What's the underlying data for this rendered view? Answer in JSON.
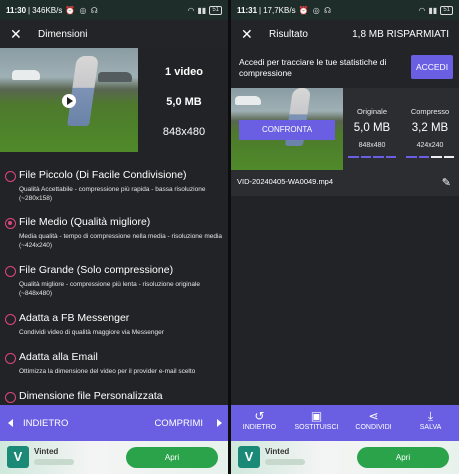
{
  "left": {
    "status": {
      "time": "11:30",
      "speed": "346KB/s",
      "battery": "51"
    },
    "appbar": {
      "title": "Dimensioni"
    },
    "video": {
      "count": "1 video",
      "size": "5,0 MB",
      "resolution": "848x480"
    },
    "options": [
      {
        "title": "File Piccolo (Di Facile Condivisione)",
        "desc": "Qualità Accettabile - compressione più rapida - bassa risoluzione (~280x158)",
        "selected": false
      },
      {
        "title": "File Medio (Qualità migliore)",
        "desc": "Media qualità - tempo di compressione nella media - risoluzione media (~424x240)",
        "selected": true
      },
      {
        "title": "File Grande (Solo compressione)",
        "desc": "Qualità migliore - compressione più lenta - risoluzione originale (~848x480)",
        "selected": false
      },
      {
        "title": "Adatta a FB Messenger",
        "desc": "Condividi video di qualità maggiore via Messenger",
        "selected": false
      },
      {
        "title": "Adatta alla Email",
        "desc": "Ottimizza la dimensione del video per il provider e-mail scelto",
        "selected": false
      },
      {
        "title": "Dimensione file Personalizzata",
        "desc": "",
        "selected": false
      }
    ],
    "nav": {
      "back": "INDIETRO",
      "next": "COMPRIMI"
    },
    "ad": {
      "name": "Vinted",
      "button": "Apri"
    }
  },
  "right": {
    "status": {
      "time": "11:31",
      "speed": "17,7KB/s",
      "battery": "51"
    },
    "appbar": {
      "title": "Risultato",
      "saved": "1,8 MB RISPARMIATI"
    },
    "promo": {
      "text": "Accedi per tracciare le tue statistiche di compressione",
      "button": "ACCEDI"
    },
    "compare_button": "CONFRONTA",
    "original": {
      "label": "Originale",
      "size": "5,0 MB",
      "resolution": "848x480"
    },
    "compressed": {
      "label": "Compresso",
      "size": "3,2 MB",
      "resolution": "424x240"
    },
    "filename": "VID-20240405-WA0049.mp4",
    "nav": [
      {
        "label": "INDIETRO",
        "icon": "undo-icon"
      },
      {
        "label": "SOSTITUISCI",
        "icon": "replace-icon"
      },
      {
        "label": "CONDIVIDI",
        "icon": "share-icon"
      },
      {
        "label": "SALVA",
        "icon": "download-icon"
      }
    ],
    "ad": {
      "name": "Vinted",
      "button": "Apri"
    }
  },
  "colors": {
    "accent": "#6a5fe3",
    "radio": "#e0457f",
    "background": "#222326"
  }
}
